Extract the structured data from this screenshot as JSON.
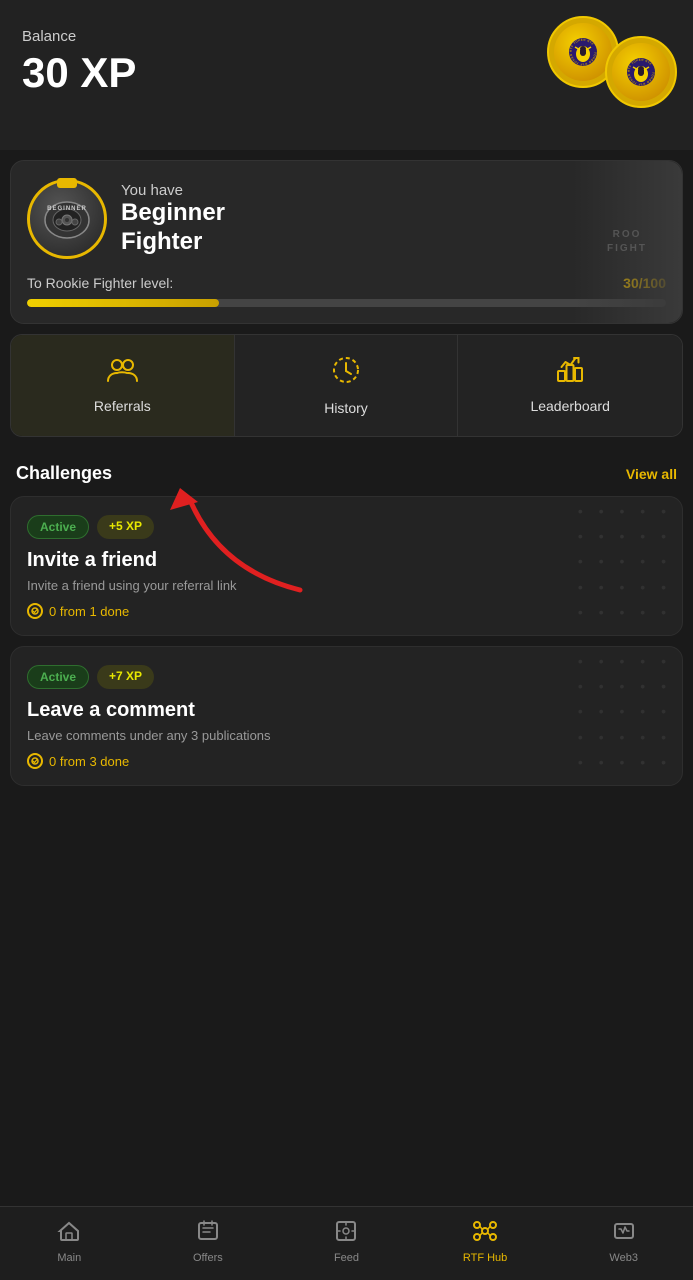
{
  "balance": {
    "label": "Balance",
    "amount": "30 XP"
  },
  "fighter": {
    "you_have": "You have",
    "level_line1": "Beginner",
    "level_line2": "Fighter",
    "badge_text": "BEGINNER",
    "progress_label": "To Rookie Fighter level:",
    "progress_current": 30,
    "progress_max": 100,
    "progress_display": "30/100",
    "bg_text": "ROO\nFIGHT"
  },
  "actions": [
    {
      "id": "referrals",
      "label": "Referrals",
      "icon": "👥",
      "active": true
    },
    {
      "id": "history",
      "label": "History",
      "icon": "🕐",
      "active": false
    },
    {
      "id": "leaderboard",
      "label": "Leaderboard",
      "icon": "📊",
      "active": false
    }
  ],
  "challenges": {
    "title": "Challenges",
    "view_all": "View all",
    "items": [
      {
        "status": "Active",
        "xp": "+5 XP",
        "title": "Invite a friend",
        "description": "Invite a friend using your referral link",
        "progress": "0 from 1 done"
      },
      {
        "status": "Active",
        "xp": "+7 XP",
        "title": "Leave a comment",
        "description": "Leave comments under any 3 publications",
        "progress": "0 from 3 done"
      }
    ]
  },
  "nav": {
    "items": [
      {
        "id": "main",
        "label": "Main",
        "active": false
      },
      {
        "id": "offers",
        "label": "Offers",
        "active": false
      },
      {
        "id": "feed",
        "label": "Feed",
        "active": false
      },
      {
        "id": "rtf-hub",
        "label": "RTF Hub",
        "active": true
      },
      {
        "id": "web3",
        "label": "Web3",
        "active": false
      }
    ]
  }
}
